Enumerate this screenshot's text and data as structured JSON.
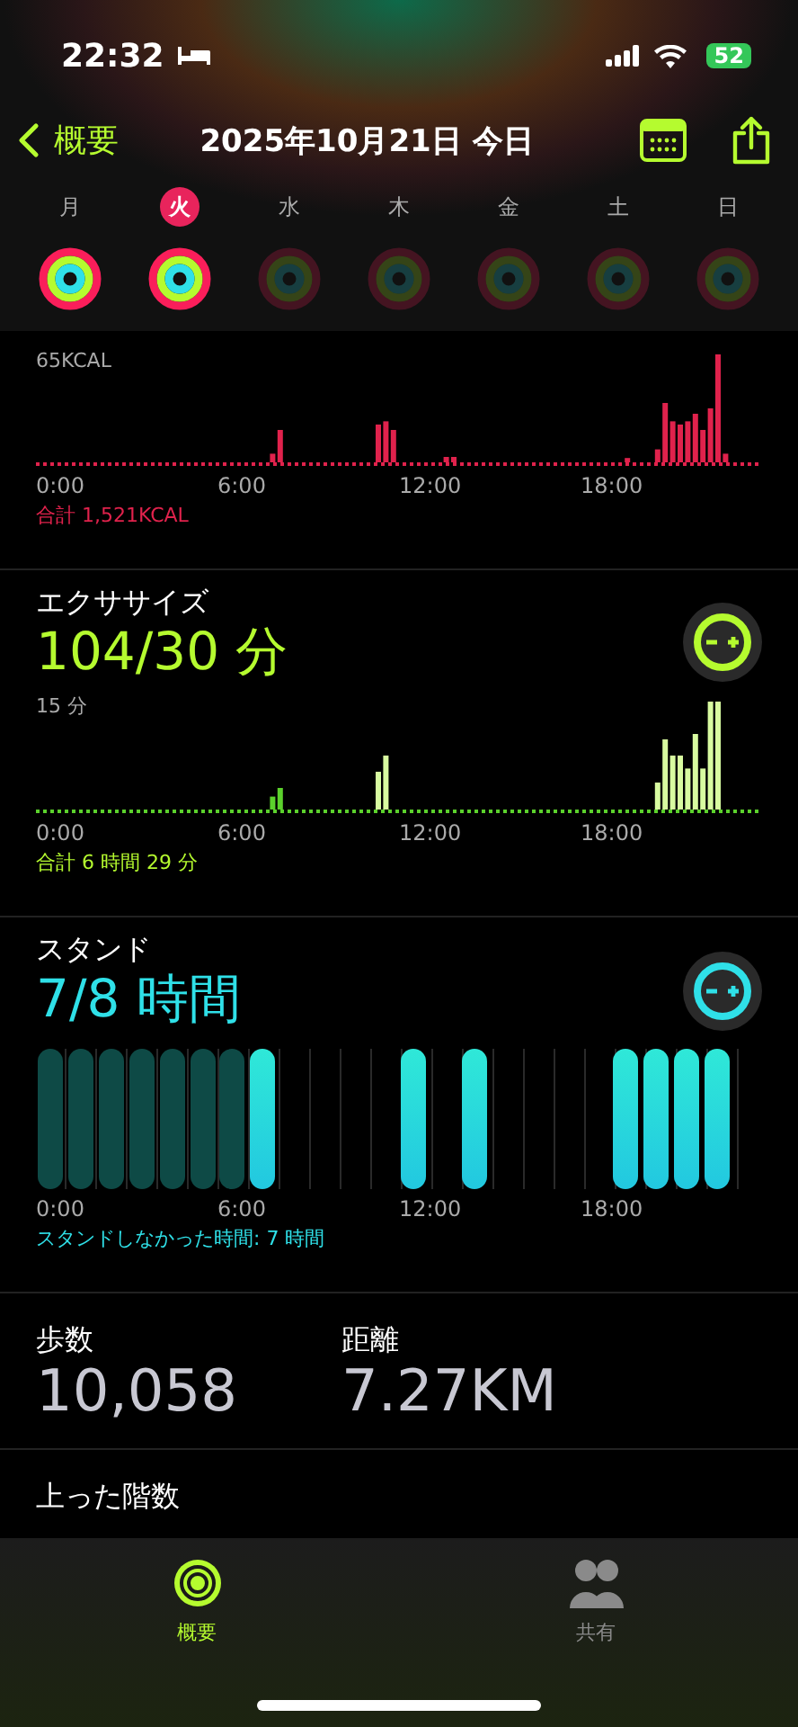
{
  "status_bar": {
    "time": "22:32",
    "battery": "52"
  },
  "nav": {
    "back": "概要",
    "title": "2025年10月21日 今日"
  },
  "days": [
    {
      "label": "月",
      "selected": false,
      "active": true
    },
    {
      "label": "火",
      "selected": true,
      "active": true
    },
    {
      "label": "水",
      "selected": false,
      "active": false
    },
    {
      "label": "木",
      "selected": false,
      "active": false
    },
    {
      "label": "金",
      "selected": false,
      "active": false
    },
    {
      "label": "土",
      "selected": false,
      "active": false
    },
    {
      "label": "日",
      "selected": false,
      "active": false
    }
  ],
  "move": {
    "max_label": "65KCAL",
    "x_labels": [
      "0:00",
      "6:00",
      "12:00",
      "18:00"
    ],
    "total": "合計 1,521KCAL"
  },
  "exercise": {
    "title": "エクササイズ",
    "value": "104/30 分",
    "max_label": "15 分",
    "x_labels": [
      "0:00",
      "6:00",
      "12:00",
      "18:00"
    ],
    "total": "合計 6 時間 29 分"
  },
  "stand": {
    "title": "スタンド",
    "value": "7/8 時間",
    "x_labels": [
      "0:00",
      "6:00",
      "12:00",
      "18:00"
    ],
    "note": "スタンドしなかった時間: 7 時間",
    "hours": [
      {
        "kind": "missed"
      },
      {
        "kind": "missed"
      },
      {
        "kind": "missed"
      },
      {
        "kind": "missed"
      },
      {
        "kind": "missed"
      },
      {
        "kind": "missed"
      },
      {
        "kind": "missed"
      },
      {
        "kind": "stood"
      },
      {
        "kind": "empty"
      },
      {
        "kind": "empty"
      },
      {
        "kind": "empty"
      },
      {
        "kind": "empty"
      },
      {
        "kind": "stood"
      },
      {
        "kind": "empty"
      },
      {
        "kind": "stood"
      },
      {
        "kind": "empty"
      },
      {
        "kind": "empty"
      },
      {
        "kind": "empty"
      },
      {
        "kind": "empty"
      },
      {
        "kind": "stood"
      },
      {
        "kind": "stood"
      },
      {
        "kind": "stood"
      },
      {
        "kind": "stood"
      },
      {
        "kind": "empty"
      }
    ]
  },
  "stats": [
    {
      "label": "歩数",
      "value": "10,058"
    },
    {
      "label": "距離",
      "value": "7.27KM"
    }
  ],
  "next_section": "上った階数",
  "tabs": [
    {
      "label": "概要",
      "selected": true
    },
    {
      "label": "共有",
      "selected": false
    }
  ]
}
